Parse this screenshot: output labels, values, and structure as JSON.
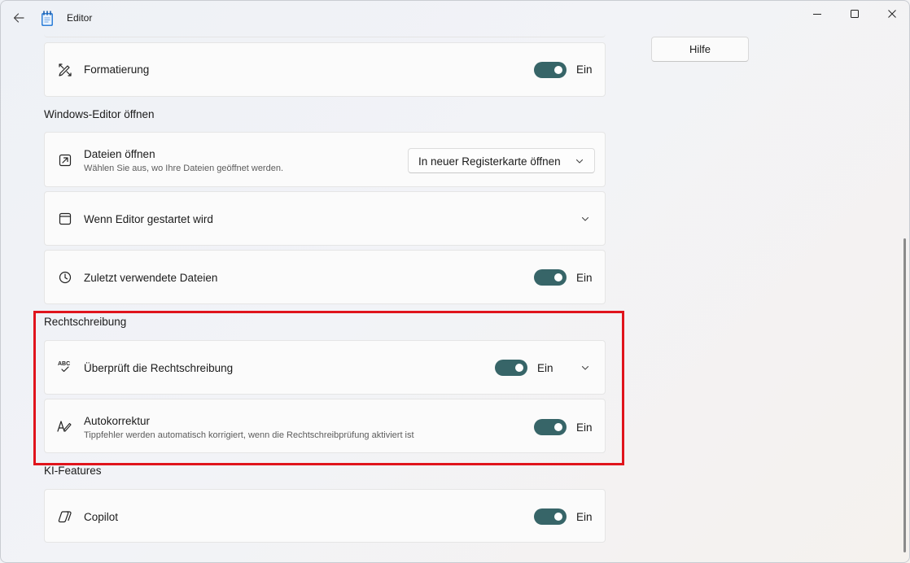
{
  "window": {
    "title": "Editor"
  },
  "help_button": "Hilfe",
  "formatting": {
    "title": "Formatierung",
    "state": "Ein"
  },
  "section_open": {
    "heading": "Windows-Editor öffnen"
  },
  "open_files": {
    "title": "Dateien öffnen",
    "subtitle": "Wählen Sie aus, wo Ihre Dateien geöffnet werden.",
    "dropdown_value": "In neuer Registerkarte öffnen"
  },
  "on_start": {
    "title": "Wenn Editor gestartet wird"
  },
  "recent_files": {
    "title": "Zuletzt verwendete Dateien",
    "state": "Ein"
  },
  "section_spelling": {
    "heading": "Rechtschreibung"
  },
  "spellcheck": {
    "title": "Überprüft die Rechtschreibung",
    "state": "Ein",
    "icon_text": "ABC"
  },
  "autocorrect": {
    "title": "Autokorrektur",
    "subtitle": "Tippfehler werden automatisch korrigiert, wenn die Rechtschreibprüfung aktiviert ist",
    "state": "Ein"
  },
  "section_ai": {
    "heading": "KI-Features"
  },
  "copilot": {
    "title": "Copilot",
    "state": "Ein"
  },
  "colors": {
    "toggle_on": "#376568",
    "highlight": "#e0141c"
  }
}
